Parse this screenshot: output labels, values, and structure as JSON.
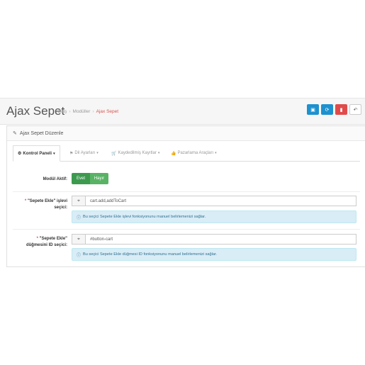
{
  "header": {
    "title": "Ajax Sepet",
    "breadcrumbs": [
      "Giriş",
      "Modüller",
      "Ajax Sepet"
    ],
    "buttons": {
      "save": "💾",
      "refresh": "⟳",
      "delete": "🗑",
      "back": "↶"
    }
  },
  "panel": {
    "heading": "Ajax Sepet Düzenle",
    "tabs": [
      {
        "label": "Kontrol Paneli",
        "icon": "gear-icon"
      },
      {
        "label": "Dil Ayarları",
        "icon": "flag-icon"
      },
      {
        "label": "Kaydedilmiş Kayıtlar",
        "icon": "cart-icon"
      },
      {
        "label": "Pazarlama Araçları",
        "icon": "thumbs-up-icon"
      }
    ]
  },
  "form": {
    "module_active": {
      "label": "Modül Aktif:",
      "on": "Evet",
      "off": "Hayır"
    },
    "button_func": {
      "label_line1": "\"Sepete Ekle\" işlevi",
      "label_line2": "seçici:",
      "value": "cart.add,addToCart",
      "help": "Bu seçici Sepete Ekle işlevi fonksiyonunu manuel belirlemenizi sağlar."
    },
    "button_id": {
      "label_line1": "\"Sepete Ekle\"",
      "label_line2": "düğmesini ID seçici:",
      "value": "#button-cart",
      "help": "Bu seçici Sepete Ekle düğmesi ID fonksiyonunu manuel belirlemenizi sağlar."
    }
  }
}
